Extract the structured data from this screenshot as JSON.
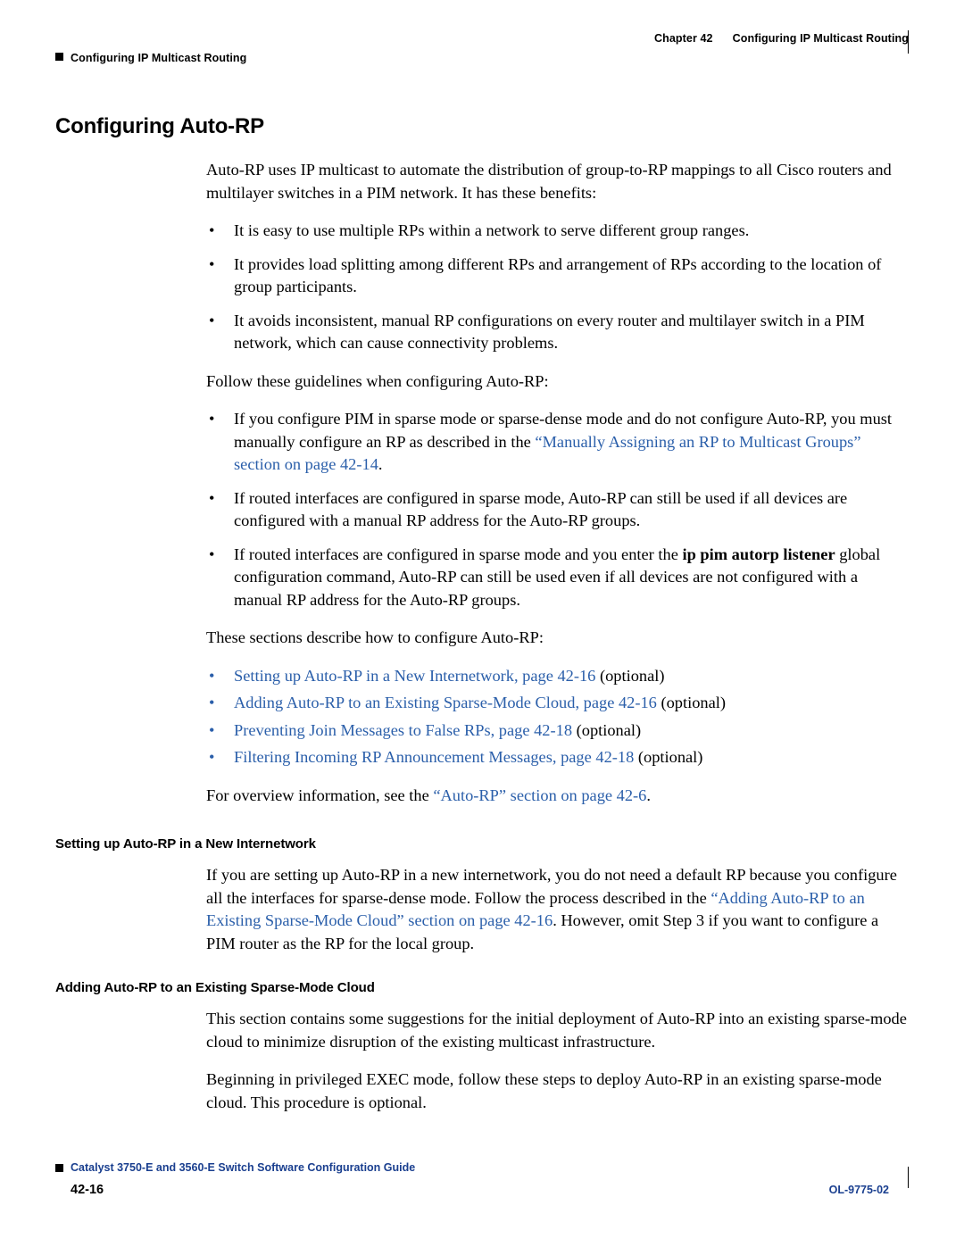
{
  "header": {
    "chapter_label": "Chapter 42",
    "chapter_title": "Configuring IP Multicast Routing",
    "running_head": "Configuring IP Multicast Routing"
  },
  "title": "Configuring Auto-RP",
  "intro": "Auto-RP uses IP multicast to automate the distribution of group-to-RP mappings to all Cisco routers and multilayer switches in a PIM network. It has these benefits:",
  "benefits": [
    "It is easy to use multiple RPs within a network to serve different group ranges.",
    "It provides load splitting among different RPs and arrangement of RPs according to the location of group participants.",
    "It avoids inconsistent, manual RP configurations on every router and multilayer switch in a PIM network, which can cause connectivity problems."
  ],
  "guidelines_lead": "Follow these guidelines when configuring Auto-RP:",
  "guidelines": [
    {
      "pre": "If you configure PIM in sparse mode or sparse-dense mode and do not configure Auto-RP, you must manually configure an RP as described in the ",
      "link": "“Manually Assigning an RP to Multicast Groups” section on page 42-14",
      "post": "."
    },
    {
      "pre": "If routed interfaces are configured in sparse mode, Auto-RP can still be used if all devices are configured with a manual RP address for the Auto-RP groups.",
      "link": "",
      "post": ""
    },
    {
      "pre": "If routed interfaces are configured in sparse mode and you enter the ",
      "bold": "ip pim autorp listener",
      "post": " global configuration command, Auto-RP can still be used even if all devices are not configured with a manual RP address for the Auto-RP groups."
    }
  ],
  "sections_lead": "These sections describe how to configure Auto-RP:",
  "section_links": [
    {
      "link": "Setting up Auto-RP in a New Internetwork, page 42-16",
      "suffix": " (optional)"
    },
    {
      "link": "Adding Auto-RP to an Existing Sparse-Mode Cloud, page 42-16",
      "suffix": " (optional)"
    },
    {
      "link": "Preventing Join Messages to False RPs, page 42-18",
      "suffix": " (optional)"
    },
    {
      "link": "Filtering Incoming RP Announcement Messages, page 42-18",
      "suffix": " (optional)"
    }
  ],
  "overview": {
    "pre": "For overview information, see the ",
    "link": "“Auto-RP” section on page 42-6",
    "post": "."
  },
  "subsection1": {
    "heading": "Setting up Auto-RP in a New Internetwork",
    "pre": "If you are setting up Auto-RP in a new internetwork, you do not need a default RP because you configure all the interfaces for sparse-dense mode. Follow the process described in the ",
    "link": "“Adding Auto-RP to an Existing Sparse-Mode Cloud” section on page 42-16",
    "post": ". However, omit Step 3 if you want to configure a PIM router as the RP for the local group."
  },
  "subsection2": {
    "heading": "Adding Auto-RP to an Existing Sparse-Mode Cloud",
    "para1": "This section contains some suggestions for the initial deployment of Auto-RP into an existing sparse-mode cloud to minimize disruption of the existing multicast infrastructure.",
    "para2": "Beginning in privileged EXEC mode, follow these steps to deploy Auto-RP in an existing sparse-mode cloud. This procedure is optional."
  },
  "footer": {
    "guide_title": "Catalyst 3750-E and 3560-E Switch Software Configuration Guide",
    "page_number": "42-16",
    "doc_number": "OL-9775-02"
  },
  "colors": {
    "link": "#2b5faa",
    "footer_blue": "#1a3f8f"
  }
}
